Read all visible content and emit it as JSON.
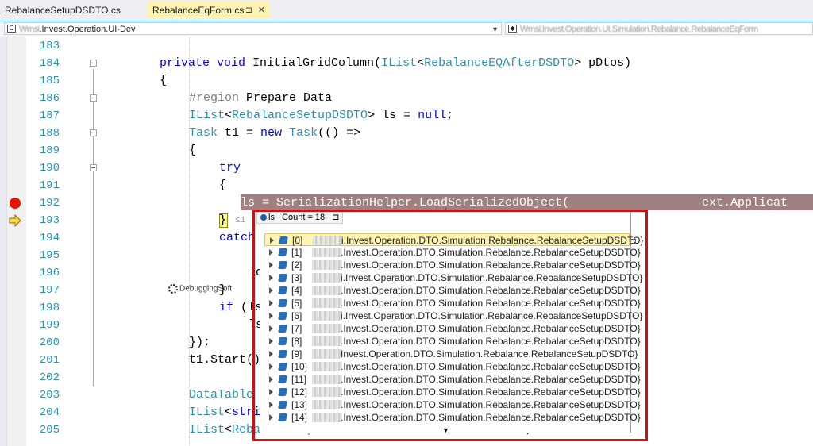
{
  "tabs": [
    {
      "label": "RebalanceSetupDSDTO.cs",
      "active": false
    },
    {
      "label": "RebalanceEqForm.cs",
      "active": true,
      "pin": "⊐",
      "close": "✕"
    }
  ],
  "navbar": {
    "left_prefix": "Wmsi",
    "left_text": ".Invest.Operation.UI-Dev",
    "left_arrow": "▼",
    "right_text": "Wmsi.Invest.Operation.UI.Simulation.Rebalance.RebalanceEqForm"
  },
  "lines": [
    {
      "num": "183",
      "code": ""
    },
    {
      "num": "184",
      "code": "private void InitialGridColumn(IList<RebalanceEQAfterDSDTO> pDtos)"
    },
    {
      "num": "185",
      "code": "{"
    },
    {
      "num": "186",
      "code": "#region Prepare Data"
    },
    {
      "num": "187",
      "code": "IList<RebalanceSetupDSDTO> ls = null;"
    },
    {
      "num": "188",
      "code": "Task t1 = new Task(() =>"
    },
    {
      "num": "189",
      "code": "{"
    },
    {
      "num": "190",
      "code": "try"
    },
    {
      "num": "191",
      "code": "{"
    },
    {
      "num": "192",
      "code": "ls = SerializationHelper.LoadSerializedObject("
    },
    {
      "num": "193",
      "code": "}"
    },
    {
      "num": "194",
      "code": "catch"
    },
    {
      "num": "195",
      "code": ""
    },
    {
      "num": "196",
      "code": "lo"
    },
    {
      "num": "197",
      "code": "}"
    },
    {
      "num": "198",
      "code": "if (ls"
    },
    {
      "num": "199",
      "code": "ls"
    },
    {
      "num": "200",
      "code": "});"
    },
    {
      "num": "201",
      "code": "t1.Start()"
    },
    {
      "num": "202",
      "code": ""
    },
    {
      "num": "203",
      "code": "DataTable"
    },
    {
      "num": "204",
      "code": "IList<stri"
    },
    {
      "num": "205",
      "code": "IList<RebalanceEqControlDSDTO> controlls = null;"
    }
  ],
  "line192_tail": "ext.Applicat",
  "line193_hint": "≤1",
  "datatip": {
    "header_var": "ls",
    "header_count": "Count = 18",
    "header_pin": "⊐",
    "items": [
      {
        "index": "[0]",
        "value": "i.Invest.Operation.DTO.Simulation.Rebalance.RebalanceSetupDSDTO}"
      },
      {
        "index": "[1]",
        "value": ".Invest.Operation.DTO.Simulation.Rebalance.RebalanceSetupDSDTO}"
      },
      {
        "index": "[2]",
        "value": ".Invest.Operation.DTO.Simulation.Rebalance.RebalanceSetupDSDTO}"
      },
      {
        "index": "[3]",
        "value": "i.Invest.Operation.DTO.Simulation.Rebalance.RebalanceSetupDSDTO}"
      },
      {
        "index": "[4]",
        "value": ".Invest.Operation.DTO.Simulation.Rebalance.RebalanceSetupDSDTO}"
      },
      {
        "index": "[5]",
        "value": ".Invest.Operation.DTO.Simulation.Rebalance.RebalanceSetupDSDTO}"
      },
      {
        "index": "[6]",
        "value": "i.Invest.Operation.DTO.Simulation.Rebalance.RebalanceSetupDSDTO}"
      },
      {
        "index": "[7]",
        "value": ".Invest.Operation.DTO.Simulation.Rebalance.RebalanceSetupDSDTO}"
      },
      {
        "index": "[8]",
        "value": ".Invest.Operation.DTO.Simulation.Rebalance.RebalanceSetupDSDTO}"
      },
      {
        "index": "[9]",
        "value": "Invest.Operation.DTO.Simulation.Rebalance.RebalanceSetupDSDTO}"
      },
      {
        "index": "[10]",
        "value": ".Invest.Operation.DTO.Simulation.Rebalance.RebalanceSetupDSDTO}"
      },
      {
        "index": "[11]",
        "value": ".Invest.Operation.DTO.Simulation.Rebalance.RebalanceSetupDSDTO}"
      },
      {
        "index": "[12]",
        "value": ".Invest.Operation.DTO.Simulation.Rebalance.RebalanceSetupDSDTO}"
      },
      {
        "index": "[13]",
        "value": ".Invest.Operation.DTO.Simulation.Rebalance.RebalanceSetupDSDTO}"
      },
      {
        "index": "[14]",
        "value": ".Invest.Operation.DTO.Simulation.Rebalance.RebalanceSetupDSDTO}"
      }
    ]
  },
  "watermark": "DebuggingSoft",
  "colors": {
    "breakpoint": "#e51400",
    "current_line": "#fff59a",
    "highlight_box": "#d01010",
    "keyword": "#0000ff",
    "type": "#2b91af"
  }
}
